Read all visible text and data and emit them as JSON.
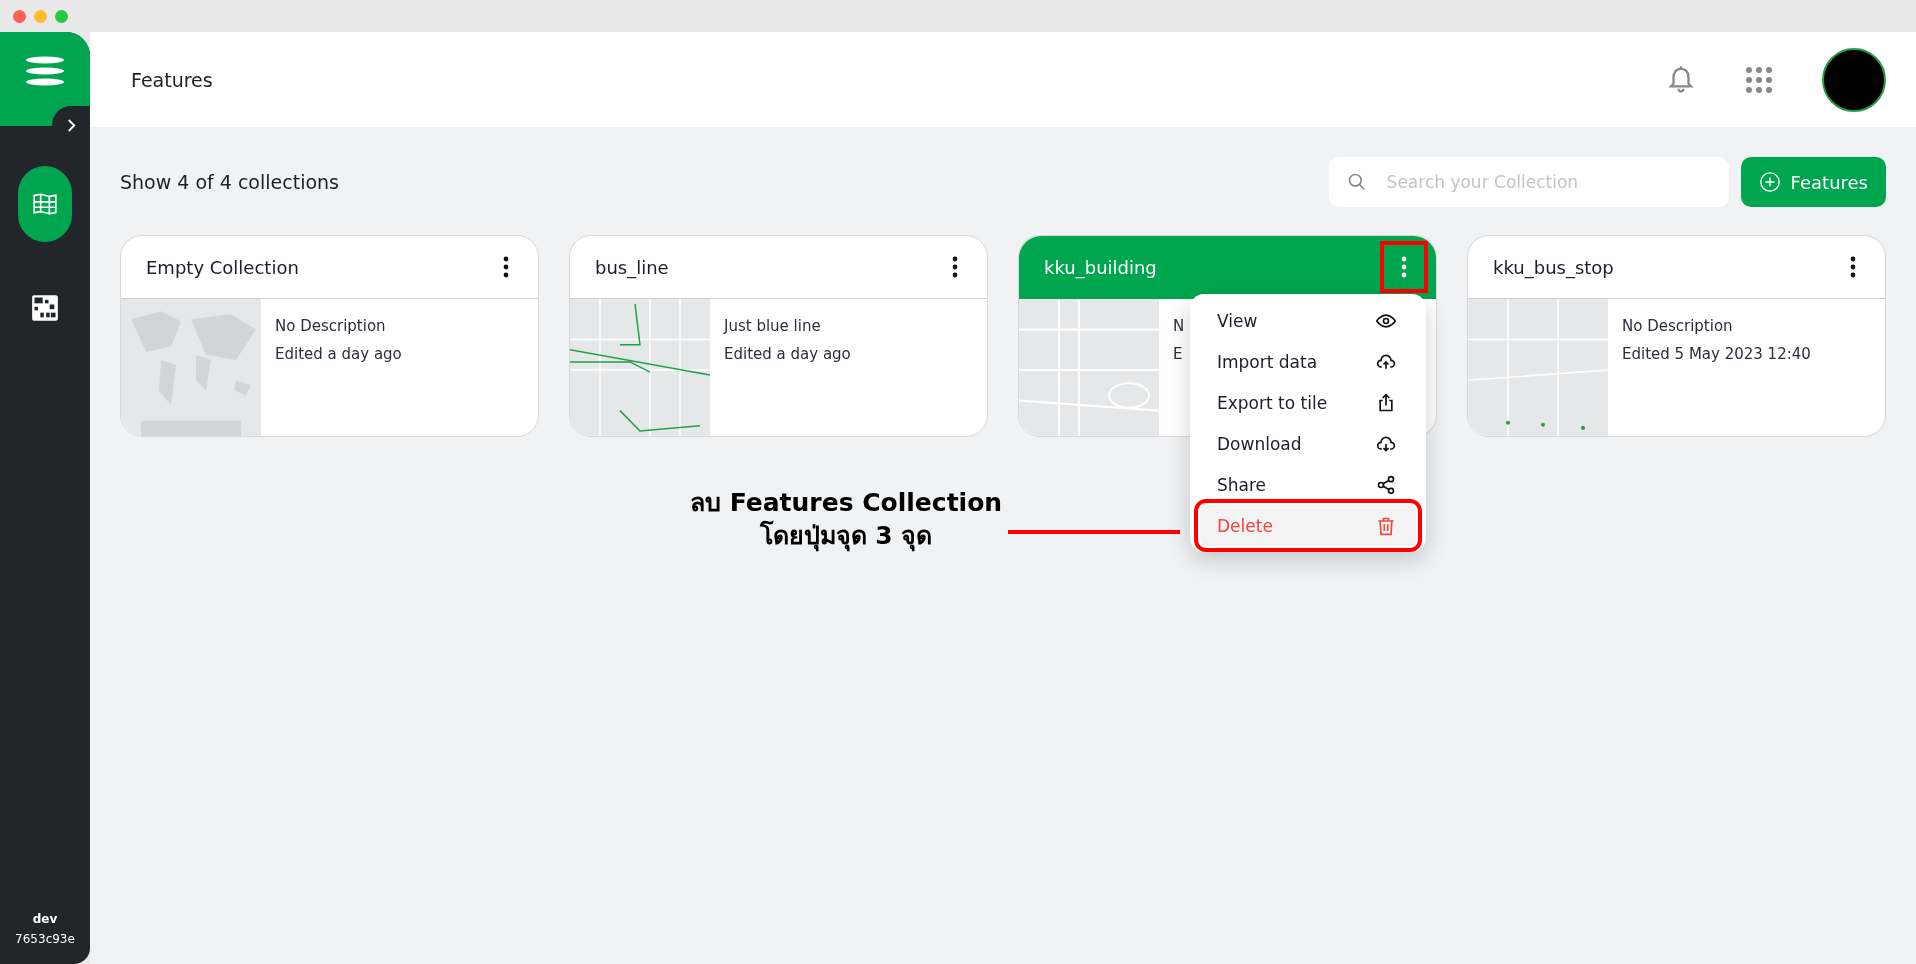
{
  "header": {
    "title": "Features"
  },
  "sidebar": {
    "items": [
      {
        "kind": "map",
        "selected": true
      },
      {
        "kind": "grid",
        "selected": false
      }
    ],
    "footer": {
      "env": "dev",
      "build": "7653c93e"
    }
  },
  "toolbar": {
    "count_text": "Show 4 of 4 collections",
    "search": {
      "placeholder": "Search your Collection"
    },
    "add_button": "Features"
  },
  "cards": [
    {
      "title": "Empty Collection",
      "description": "No Description",
      "edited": "Edited a day ago",
      "kind": "world",
      "selected": false,
      "menu_open": false,
      "marked": false
    },
    {
      "title": "bus_line",
      "description": "Just blue line",
      "edited": "Edited a day ago",
      "kind": "lines",
      "selected": false,
      "menu_open": false,
      "marked": false
    },
    {
      "title": "kku_building",
      "description": "N",
      "edited": "E",
      "kind": "campus",
      "selected": true,
      "menu_open": true,
      "marked": true
    },
    {
      "title": "kku_bus_stop",
      "description": "No Description",
      "edited": "Edited 5 May 2023 12:40",
      "kind": "stops",
      "selected": false,
      "menu_open": false,
      "marked": false
    }
  ],
  "menu": [
    {
      "label": "View",
      "kind": "view",
      "selected": false,
      "marked": false
    },
    {
      "label": "Import data",
      "kind": "upload",
      "selected": false,
      "marked": false
    },
    {
      "label": "Export to tile",
      "kind": "export",
      "selected": false,
      "marked": false
    },
    {
      "label": "Download",
      "kind": "download",
      "selected": false,
      "marked": false
    },
    {
      "label": "Share",
      "kind": "share",
      "selected": false,
      "marked": false
    },
    {
      "label": "Delete",
      "kind": "delete",
      "selected": true,
      "marked": true
    }
  ],
  "annotation": {
    "lines": [
      "ลบ Features Collection",
      "โดยปุ่มจุด 3 จุด"
    ]
  }
}
